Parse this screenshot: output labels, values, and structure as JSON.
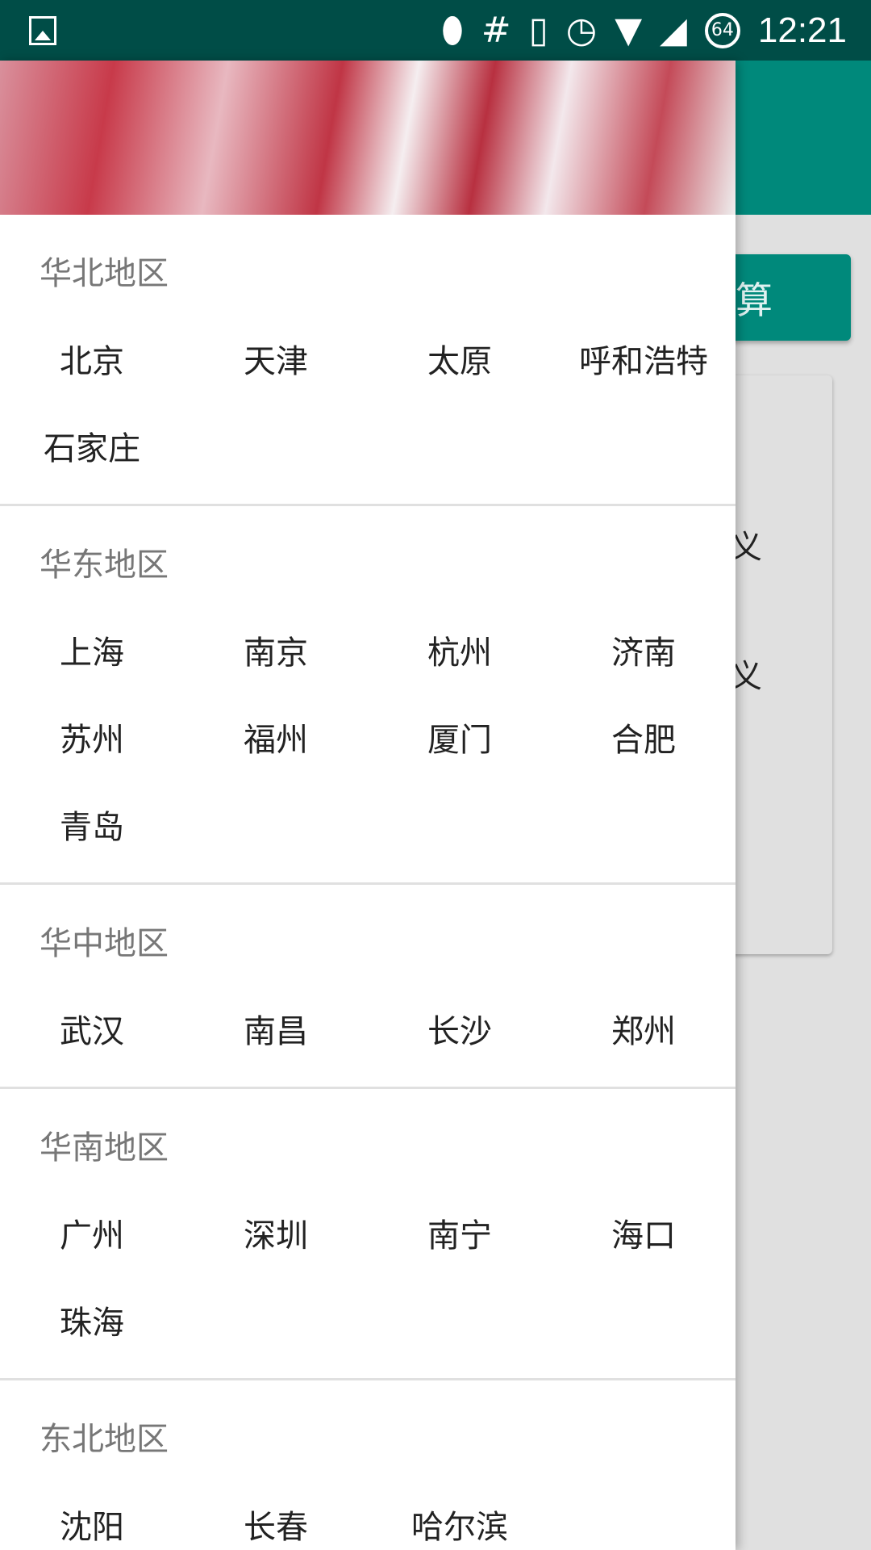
{
  "status_bar": {
    "time": "12:21",
    "battery": "64",
    "icons": [
      "image-icon",
      "location-icon",
      "hash-icon",
      "vibrate-icon",
      "alarm-icon",
      "wifi-icon",
      "signal-icon",
      "battery-icon"
    ]
  },
  "background": {
    "calc_button": "算",
    "card_lines": [
      "义",
      "义"
    ]
  },
  "colors": {
    "primary": "#00897b",
    "status_bar": "#004d47"
  },
  "drawer": {
    "sections": [
      {
        "title": "华北地区",
        "cities": [
          "北京",
          "天津",
          "太原",
          "呼和浩特",
          "石家庄"
        ]
      },
      {
        "title": "华东地区",
        "cities": [
          "上海",
          "南京",
          "杭州",
          "济南",
          "苏州",
          "福州",
          "厦门",
          "合肥",
          "青岛"
        ]
      },
      {
        "title": "华中地区",
        "cities": [
          "武汉",
          "南昌",
          "长沙",
          "郑州"
        ]
      },
      {
        "title": "华南地区",
        "cities": [
          "广州",
          "深圳",
          "南宁",
          "海口",
          "珠海"
        ]
      },
      {
        "title": "东北地区",
        "cities": [
          "沈阳",
          "长春",
          "哈尔滨"
        ]
      }
    ]
  }
}
